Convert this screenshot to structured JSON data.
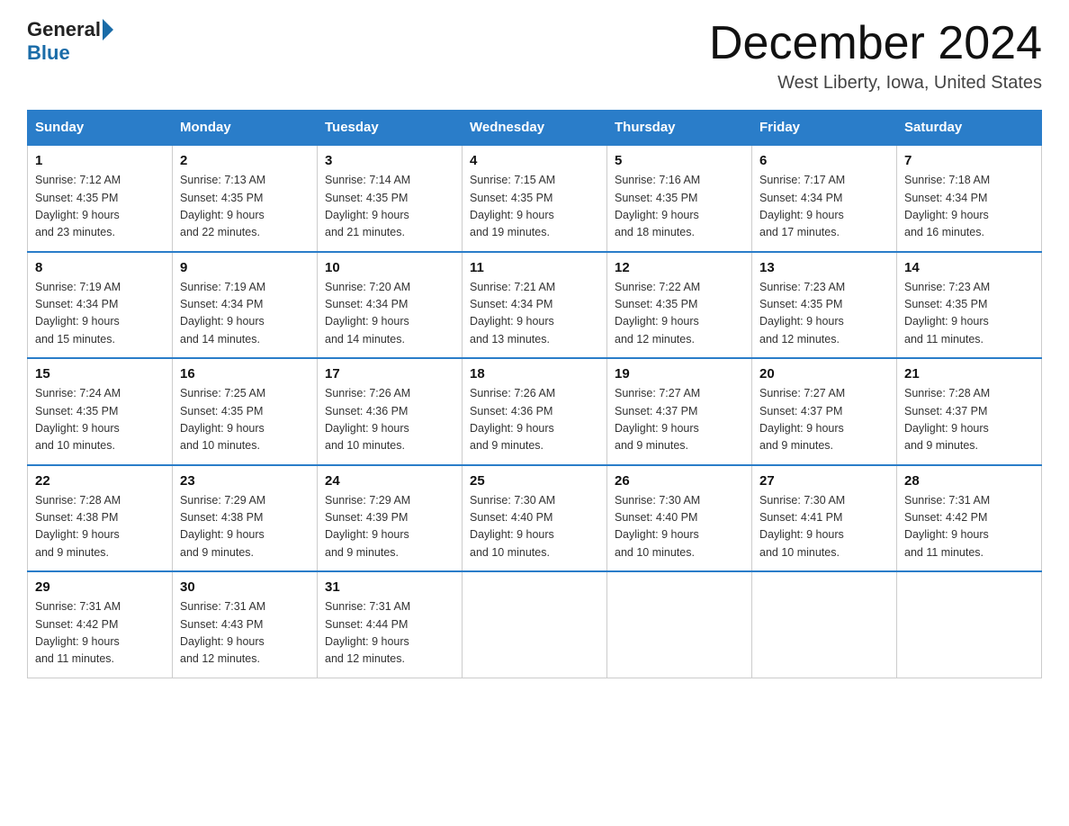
{
  "header": {
    "title": "December 2024",
    "subtitle": "West Liberty, Iowa, United States",
    "logo_general": "General",
    "logo_blue": "Blue"
  },
  "weekdays": [
    "Sunday",
    "Monday",
    "Tuesday",
    "Wednesday",
    "Thursday",
    "Friday",
    "Saturday"
  ],
  "weeks": [
    [
      {
        "day": "1",
        "sunrise": "7:12 AM",
        "sunset": "4:35 PM",
        "daylight": "9 hours and 23 minutes."
      },
      {
        "day": "2",
        "sunrise": "7:13 AM",
        "sunset": "4:35 PM",
        "daylight": "9 hours and 22 minutes."
      },
      {
        "day": "3",
        "sunrise": "7:14 AM",
        "sunset": "4:35 PM",
        "daylight": "9 hours and 21 minutes."
      },
      {
        "day": "4",
        "sunrise": "7:15 AM",
        "sunset": "4:35 PM",
        "daylight": "9 hours and 19 minutes."
      },
      {
        "day": "5",
        "sunrise": "7:16 AM",
        "sunset": "4:35 PM",
        "daylight": "9 hours and 18 minutes."
      },
      {
        "day": "6",
        "sunrise": "7:17 AM",
        "sunset": "4:34 PM",
        "daylight": "9 hours and 17 minutes."
      },
      {
        "day": "7",
        "sunrise": "7:18 AM",
        "sunset": "4:34 PM",
        "daylight": "9 hours and 16 minutes."
      }
    ],
    [
      {
        "day": "8",
        "sunrise": "7:19 AM",
        "sunset": "4:34 PM",
        "daylight": "9 hours and 15 minutes."
      },
      {
        "day": "9",
        "sunrise": "7:19 AM",
        "sunset": "4:34 PM",
        "daylight": "9 hours and 14 minutes."
      },
      {
        "day": "10",
        "sunrise": "7:20 AM",
        "sunset": "4:34 PM",
        "daylight": "9 hours and 14 minutes."
      },
      {
        "day": "11",
        "sunrise": "7:21 AM",
        "sunset": "4:34 PM",
        "daylight": "9 hours and 13 minutes."
      },
      {
        "day": "12",
        "sunrise": "7:22 AM",
        "sunset": "4:35 PM",
        "daylight": "9 hours and 12 minutes."
      },
      {
        "day": "13",
        "sunrise": "7:23 AM",
        "sunset": "4:35 PM",
        "daylight": "9 hours and 12 minutes."
      },
      {
        "day": "14",
        "sunrise": "7:23 AM",
        "sunset": "4:35 PM",
        "daylight": "9 hours and 11 minutes."
      }
    ],
    [
      {
        "day": "15",
        "sunrise": "7:24 AM",
        "sunset": "4:35 PM",
        "daylight": "9 hours and 10 minutes."
      },
      {
        "day": "16",
        "sunrise": "7:25 AM",
        "sunset": "4:35 PM",
        "daylight": "9 hours and 10 minutes."
      },
      {
        "day": "17",
        "sunrise": "7:26 AM",
        "sunset": "4:36 PM",
        "daylight": "9 hours and 10 minutes."
      },
      {
        "day": "18",
        "sunrise": "7:26 AM",
        "sunset": "4:36 PM",
        "daylight": "9 hours and 9 minutes."
      },
      {
        "day": "19",
        "sunrise": "7:27 AM",
        "sunset": "4:37 PM",
        "daylight": "9 hours and 9 minutes."
      },
      {
        "day": "20",
        "sunrise": "7:27 AM",
        "sunset": "4:37 PM",
        "daylight": "9 hours and 9 minutes."
      },
      {
        "day": "21",
        "sunrise": "7:28 AM",
        "sunset": "4:37 PM",
        "daylight": "9 hours and 9 minutes."
      }
    ],
    [
      {
        "day": "22",
        "sunrise": "7:28 AM",
        "sunset": "4:38 PM",
        "daylight": "9 hours and 9 minutes."
      },
      {
        "day": "23",
        "sunrise": "7:29 AM",
        "sunset": "4:38 PM",
        "daylight": "9 hours and 9 minutes."
      },
      {
        "day": "24",
        "sunrise": "7:29 AM",
        "sunset": "4:39 PM",
        "daylight": "9 hours and 9 minutes."
      },
      {
        "day": "25",
        "sunrise": "7:30 AM",
        "sunset": "4:40 PM",
        "daylight": "9 hours and 10 minutes."
      },
      {
        "day": "26",
        "sunrise": "7:30 AM",
        "sunset": "4:40 PM",
        "daylight": "9 hours and 10 minutes."
      },
      {
        "day": "27",
        "sunrise": "7:30 AM",
        "sunset": "4:41 PM",
        "daylight": "9 hours and 10 minutes."
      },
      {
        "day": "28",
        "sunrise": "7:31 AM",
        "sunset": "4:42 PM",
        "daylight": "9 hours and 11 minutes."
      }
    ],
    [
      {
        "day": "29",
        "sunrise": "7:31 AM",
        "sunset": "4:42 PM",
        "daylight": "9 hours and 11 minutes."
      },
      {
        "day": "30",
        "sunrise": "7:31 AM",
        "sunset": "4:43 PM",
        "daylight": "9 hours and 12 minutes."
      },
      {
        "day": "31",
        "sunrise": "7:31 AM",
        "sunset": "4:44 PM",
        "daylight": "9 hours and 12 minutes."
      },
      null,
      null,
      null,
      null
    ]
  ]
}
